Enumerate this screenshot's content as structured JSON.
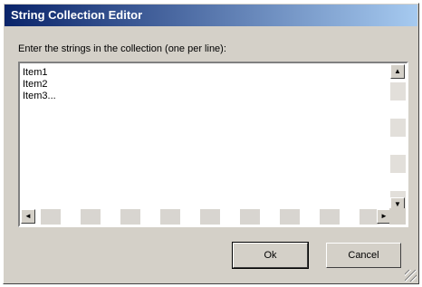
{
  "window": {
    "title": "String Collection Editor"
  },
  "prompt": "Enter the strings in the collection (one per line):",
  "editor": {
    "lines": [
      "Item1",
      "Item2",
      "Item3..."
    ]
  },
  "buttons": {
    "ok": "Ok",
    "cancel": "Cancel"
  },
  "icons": {
    "scroll_up": "▲",
    "scroll_down": "▼",
    "scroll_left": "◄",
    "scroll_right": "►"
  }
}
